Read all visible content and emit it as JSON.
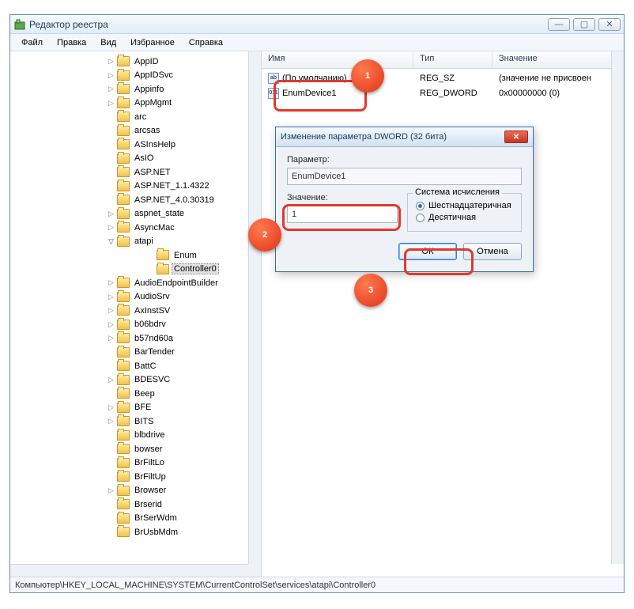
{
  "window": {
    "title": "Редактор реестра",
    "controls": {
      "min": "—",
      "max": "▢",
      "close": "✕"
    }
  },
  "menu": [
    "Файл",
    "Правка",
    "Вид",
    "Избранное",
    "Справка"
  ],
  "tree": [
    {
      "label": "AppID",
      "exp": ">"
    },
    {
      "label": "AppIDSvc",
      "exp": ">"
    },
    {
      "label": "Appinfo",
      "exp": ">"
    },
    {
      "label": "AppMgmt",
      "exp": ">"
    },
    {
      "label": "arc",
      "exp": ""
    },
    {
      "label": "arcsas",
      "exp": ""
    },
    {
      "label": "ASInsHelp",
      "exp": ""
    },
    {
      "label": "AsIO",
      "exp": ""
    },
    {
      "label": "ASP.NET",
      "exp": ""
    },
    {
      "label": "ASP.NET_1.1.4322",
      "exp": ""
    },
    {
      "label": "ASP.NET_4.0.30319",
      "exp": ""
    },
    {
      "label": "aspnet_state",
      "exp": ">"
    },
    {
      "label": "AsyncMac",
      "exp": ">"
    },
    {
      "label": "atapi",
      "exp": "v",
      "expanded": true,
      "children": [
        {
          "label": "Enum"
        },
        {
          "label": "Controller0",
          "selected": true
        }
      ]
    },
    {
      "label": "AudioEndpointBuilder",
      "exp": ">"
    },
    {
      "label": "AudioSrv",
      "exp": ">"
    },
    {
      "label": "AxInstSV",
      "exp": ">"
    },
    {
      "label": "b06bdrv",
      "exp": ">"
    },
    {
      "label": "b57nd60a",
      "exp": ">"
    },
    {
      "label": "BarTender",
      "exp": ""
    },
    {
      "label": "BattC",
      "exp": ""
    },
    {
      "label": "BDESVC",
      "exp": ">"
    },
    {
      "label": "Beep",
      "exp": ""
    },
    {
      "label": "BFE",
      "exp": ">"
    },
    {
      "label": "BITS",
      "exp": ">"
    },
    {
      "label": "blbdrive",
      "exp": ""
    },
    {
      "label": "bowser",
      "exp": ""
    },
    {
      "label": "BrFiltLo",
      "exp": ""
    },
    {
      "label": "BrFiltUp",
      "exp": ""
    },
    {
      "label": "Browser",
      "exp": ">"
    },
    {
      "label": "Brserid",
      "exp": ""
    },
    {
      "label": "BrSerWdm",
      "exp": ""
    },
    {
      "label": "BrUsbMdm",
      "exp": ""
    }
  ],
  "list": {
    "columns": {
      "name": "Имя",
      "type": "Тип",
      "value": "Значение"
    },
    "rows": [
      {
        "icon": "ab",
        "name": "(По умолчанию)",
        "type": "REG_SZ",
        "value": "(значение не присвоен"
      },
      {
        "icon": "011",
        "name": "EnumDevice1",
        "type": "REG_DWORD",
        "value": "0x00000000 (0)"
      }
    ]
  },
  "dialog": {
    "title": "Изменение параметра DWORD (32 бита)",
    "param_label": "Параметр:",
    "param_value": "EnumDevice1",
    "value_label": "Значение:",
    "value_input": "1",
    "base_label": "Система исчисления",
    "radio_hex": "Шестнадцатеричная",
    "radio_dec": "Десятичная",
    "ok": "ОК",
    "cancel": "Отмена"
  },
  "status": "Компьютер\\HKEY_LOCAL_MACHINE\\SYSTEM\\CurrentControlSet\\services\\atapi\\Controller0",
  "annot": {
    "1": "1",
    "2": "2",
    "3": "3"
  }
}
